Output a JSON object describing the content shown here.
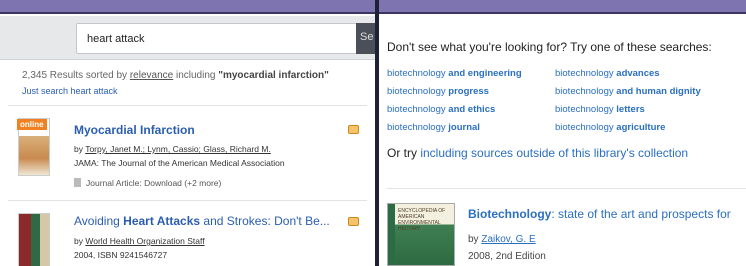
{
  "left": {
    "search": {
      "query": "heart attack",
      "button_label": "Se"
    },
    "summary": {
      "count_text": "2,345 Results sorted by ",
      "sort_label": "relevance",
      "including_text": " including ",
      "including_term": "\"myocardial infarction\"",
      "just_search": "Just search heart attack"
    },
    "results": [
      {
        "badge": "online",
        "title": "Myocardial Infarction",
        "by": "by ",
        "authors": "Torpy, Janet M.; Lynm, Cassio; Glass, Richard M.",
        "source": "JAMA: The Journal of the American Medical Association",
        "format": "Journal Article: Download (+2 more)"
      },
      {
        "title_pre": "Avoiding ",
        "title_bold": "Heart Attacks",
        "title_post": " and Strokes: Don't Be...",
        "by": "by ",
        "authors": "World Health Organization Staff",
        "edition": "2004, ISBN 9241546727"
      }
    ]
  },
  "right": {
    "heading": "Don't see what you're looking for? Try one of these searches:",
    "suggestions": [
      {
        "base": "biotechnology",
        "extra": "and engineering"
      },
      {
        "base": "biotechnology",
        "extra": "advances"
      },
      {
        "base": "biotechnology",
        "extra": "progress"
      },
      {
        "base": "biotechnology",
        "extra": "and human dignity"
      },
      {
        "base": "biotechnology",
        "extra": "and ethics"
      },
      {
        "base": "biotechnology",
        "extra": "letters"
      },
      {
        "base": "biotechnology",
        "extra": "journal"
      },
      {
        "base": "biotechnology",
        "extra": "agriculture"
      }
    ],
    "or_try_text": "Or try ",
    "or_try_link": "including sources outside of this library's collection",
    "book": {
      "title_bold": "Biotechnology",
      "title_rest": ": state of the art and prospects for",
      "by": "by ",
      "author": "Zaikov, G. E",
      "year": "2008, 2nd Edition",
      "cover_text": "ENCYCLOPEDIA OF AMERICAN ENVIRONMENTAL HISTORY"
    }
  },
  "colors": {
    "header_band": "#7e74b0",
    "link_blue": "#2a6fc0",
    "badge_orange": "#f08020",
    "divider_dark": "#1e2236"
  }
}
